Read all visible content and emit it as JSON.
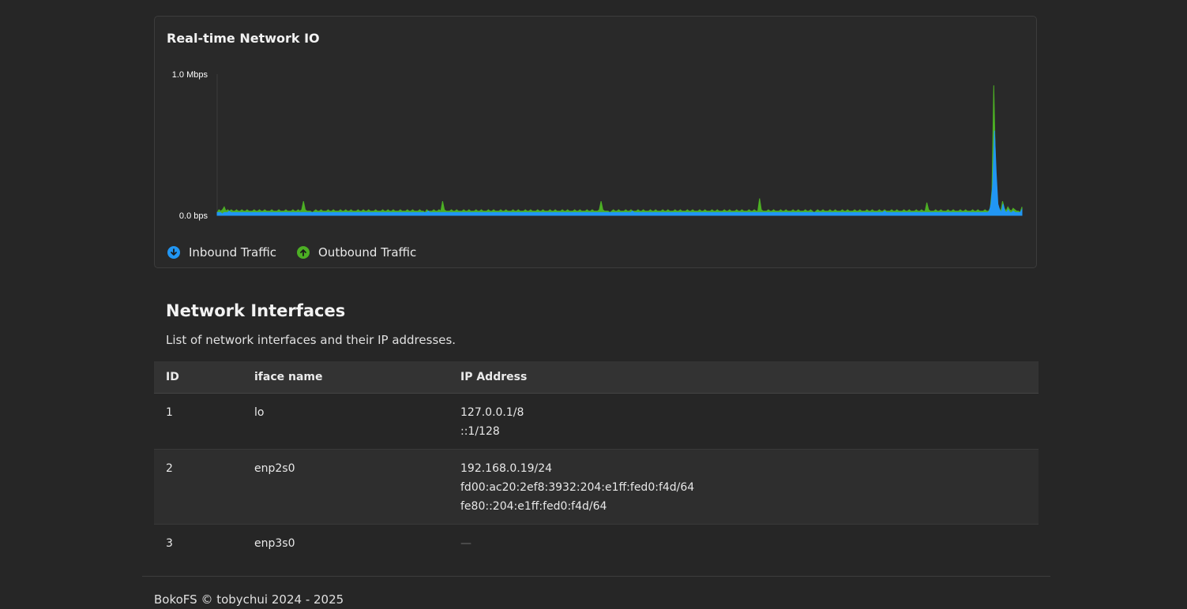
{
  "chart": {
    "title": "Real-time Network IO",
    "colors": {
      "inbound": "#2196f3",
      "outbound": "#4caf24"
    },
    "legend_icons": {
      "inbound": "arrow-down-circle-icon",
      "outbound": "arrow-up-circle-icon"
    }
  },
  "chart_data": {
    "type": "area",
    "title": "Real-time Network IO",
    "ytick_labels": [
      "1.0 Mbps",
      "0.0 bps"
    ],
    "ylim": [
      0,
      1.0
    ],
    "yunit": "Mbps",
    "grid": false,
    "legend_position": "bottom-left",
    "series": [
      {
        "name": "Inbound Traffic",
        "color": "#2196f3",
        "values": [
          0.02,
          0.02,
          0.02,
          0.01,
          0.02,
          0.02,
          0.02,
          0.03,
          0.02,
          0.02,
          0.02,
          0.02,
          0.02,
          0.02,
          0.02,
          0.02,
          0.02,
          0.02,
          0.02,
          0.02,
          0.02,
          0.02,
          0.02,
          0.02,
          0.02,
          0.02,
          0.02,
          0.02,
          0.02,
          0.02,
          0.02,
          0.02,
          0.02,
          0.02,
          0.02,
          0.02,
          0.02,
          0.02,
          0.02,
          0.02,
          0.02,
          0.02,
          0.02,
          0.02,
          0.02,
          0.02,
          0.02,
          0.02,
          0.02,
          0.02,
          0.02,
          0.02,
          0.02,
          0.02,
          0.02,
          0.02,
          0.02,
          0.02,
          0.02,
          0.02,
          0.02,
          0.02,
          0.02,
          0.02,
          0.02,
          0.02,
          0.02,
          0.02,
          0.02,
          0.02,
          0.02,
          0.02,
          0.02,
          0.02,
          0.02,
          0.02,
          0.02,
          0.02,
          0.02,
          0.02,
          0.02,
          0.02,
          0.02,
          0.02,
          0.02,
          0.02,
          0.02,
          0.02,
          0.02,
          0.02,
          0.02,
          0.02,
          0.02,
          0.02,
          0.02,
          0.02,
          0.02,
          0.02,
          0.02,
          0.02,
          0.02,
          0.02,
          0.02,
          0.02,
          0.02,
          0.02,
          0.02,
          0.02,
          0.02,
          0.02,
          0.02,
          0.02,
          0.02,
          0.02,
          0.02,
          0.02,
          0.02,
          0.02,
          0.02,
          0.02,
          0.02,
          0.02,
          0.02,
          0.03,
          0.02,
          0.02,
          0.02,
          0.02,
          0.02,
          0.02,
          0.02,
          0.02,
          0.02,
          0.02,
          0.02,
          0.02,
          0.02,
          0.02,
          0.02,
          0.02,
          0.02,
          0.02,
          0.02,
          0.02,
          0.02,
          0.02,
          0.02,
          0.02,
          0.02,
          0.02,
          0.02,
          0.02,
          0.02,
          0.02,
          0.02,
          0.02,
          0.02,
          0.02,
          0.02,
          0.02,
          0.02,
          0.02,
          0.02,
          0.02,
          0.02,
          0.02,
          0.02,
          0.02,
          0.02,
          0.02,
          0.02,
          0.02,
          0.02,
          0.02,
          0.02,
          0.02,
          0.02,
          0.02,
          0.02,
          0.02,
          0.02,
          0.02,
          0.02,
          0.02,
          0.02,
          0.02,
          0.02,
          0.02,
          0.02,
          0.02,
          0.02,
          0.02,
          0.02,
          0.02,
          0.02,
          0.02,
          0.02,
          0.02,
          0.02,
          0.02,
          0.02,
          0.02,
          0.02,
          0.02,
          0.02,
          0.02,
          0.02,
          0.02,
          0.02,
          0.02,
          0.02,
          0.02,
          0.02,
          0.02,
          0.02,
          0.02,
          0.02,
          0.02,
          0.02,
          0.02,
          0.02,
          0.02,
          0.02,
          0.02,
          0.02,
          0.02,
          0.02,
          0.02,
          0.02,
          0.02,
          0.02,
          0.02,
          0.02,
          0.02,
          0.02,
          0.02,
          0.02,
          0.02,
          0.02,
          0.02,
          0.02,
          0.02,
          0.03,
          0.02,
          0.02,
          0.02,
          0.02,
          0.02,
          0.02,
          0.02,
          0.02,
          0.02,
          0.02,
          0.02,
          0.02,
          0.02,
          0.02,
          0.02,
          0.02,
          0.02,
          0.02,
          0.02,
          0.02,
          0.02,
          0.02,
          0.02,
          0.02,
          0.02,
          0.02,
          0.02,
          0.02,
          0.02,
          0.02,
          0.02,
          0.02,
          0.02,
          0.02,
          0.02,
          0.02,
          0.02,
          0.02,
          0.02,
          0.02,
          0.02,
          0.02,
          0.02,
          0.02,
          0.02,
          0.02,
          0.02,
          0.02,
          0.02,
          0.02,
          0.02,
          0.02,
          0.02,
          0.02,
          0.02,
          0.02,
          0.02,
          0.02,
          0.02,
          0.02,
          0.02,
          0.02,
          0.02,
          0.02,
          0.02,
          0.02,
          0.02,
          0.02,
          0.02,
          0.02,
          0.02,
          0.02,
          0.02,
          0.02,
          0.02,
          0.02,
          0.02,
          0.02,
          0.02,
          0.02,
          0.02,
          0.02,
          0.02,
          0.02,
          0.02,
          0.02,
          0.02,
          0.02,
          0.02,
          0.02,
          0.02,
          0.02,
          0.02,
          0.02,
          0.02,
          0.02,
          0.02,
          0.02,
          0.02,
          0.02,
          0.02,
          0.02,
          0.02,
          0.02,
          0.02,
          0.02,
          0.02,
          0.02,
          0.02,
          0.02,
          0.02,
          0.02,
          0.02,
          0.02,
          0.02,
          0.02,
          0.02,
          0.02,
          0.02,
          0.02,
          0.02,
          0.02,
          0.02,
          0.02,
          0.02,
          0.02,
          0.02,
          0.02,
          0.02,
          0.02,
          0.02,
          0.02,
          0.02,
          0.02,
          0.02,
          0.02,
          0.02,
          0.02,
          0.02,
          0.02,
          0.02,
          0.02,
          0.02,
          0.02,
          0.02,
          0.02,
          0.03,
          0.02,
          0.02,
          0.02,
          0.02,
          0.02,
          0.02,
          0.02,
          0.02,
          0.02,
          0.02,
          0.02,
          0.02,
          0.02,
          0.02,
          0.02,
          0.02,
          0.02,
          0.02,
          0.02,
          0.02,
          0.02,
          0.02,
          0.02,
          0.02,
          0.02,
          0.02,
          0.02,
          0.02,
          0.02,
          0.02,
          0.02,
          0.02,
          0.02,
          0.02,
          0.02,
          0.02,
          0.02,
          0.02,
          0.02,
          0.02,
          0.02,
          0.02,
          0.02,
          0.02,
          0.02,
          0.02,
          0.02,
          0.02,
          0.02,
          0.02,
          0.02,
          0.02,
          0.02,
          0.02,
          0.02,
          0.02,
          0.02,
          0.02,
          0.02,
          0.02,
          0.03,
          0.08,
          0.22,
          0.6,
          0.3,
          0.08,
          0.04,
          0.02,
          0.08,
          0.03,
          0.02,
          0.04,
          0.02,
          0.02,
          0.03,
          0.02,
          0.02,
          0.02,
          0.02,
          0.04
        ]
      },
      {
        "name": "Outbound Traffic",
        "color": "#4caf24",
        "values": [
          0.02,
          0.04,
          0.03,
          0.04,
          0.06,
          0.03,
          0.04,
          0.03,
          0.04,
          0.03,
          0.03,
          0.04,
          0.03,
          0.03,
          0.04,
          0.03,
          0.03,
          0.04,
          0.03,
          0.03,
          0.03,
          0.04,
          0.03,
          0.03,
          0.04,
          0.03,
          0.03,
          0.04,
          0.03,
          0.03,
          0.03,
          0.04,
          0.03,
          0.03,
          0.03,
          0.04,
          0.03,
          0.03,
          0.03,
          0.04,
          0.03,
          0.03,
          0.03,
          0.04,
          0.03,
          0.03,
          0.04,
          0.03,
          0.04,
          0.1,
          0.04,
          0.03,
          0.03,
          0.03,
          0.02,
          0.03,
          0.04,
          0.03,
          0.03,
          0.04,
          0.03,
          0.03,
          0.03,
          0.04,
          0.03,
          0.03,
          0.04,
          0.03,
          0.03,
          0.03,
          0.04,
          0.03,
          0.03,
          0.04,
          0.03,
          0.03,
          0.04,
          0.03,
          0.03,
          0.03,
          0.04,
          0.03,
          0.03,
          0.04,
          0.03,
          0.03,
          0.04,
          0.03,
          0.03,
          0.03,
          0.04,
          0.03,
          0.03,
          0.03,
          0.04,
          0.03,
          0.03,
          0.04,
          0.03,
          0.03,
          0.04,
          0.03,
          0.03,
          0.03,
          0.04,
          0.03,
          0.03,
          0.03,
          0.04,
          0.03,
          0.03,
          0.04,
          0.03,
          0.03,
          0.03,
          0.04,
          0.03,
          0.03,
          0.02,
          0.04,
          0.03,
          0.03,
          0.03,
          0.04,
          0.03,
          0.03,
          0.04,
          0.03,
          0.1,
          0.04,
          0.03,
          0.03,
          0.03,
          0.04,
          0.03,
          0.03,
          0.04,
          0.03,
          0.03,
          0.03,
          0.04,
          0.03,
          0.03,
          0.04,
          0.03,
          0.03,
          0.03,
          0.04,
          0.03,
          0.03,
          0.04,
          0.03,
          0.03,
          0.03,
          0.04,
          0.03,
          0.03,
          0.04,
          0.03,
          0.03,
          0.03,
          0.04,
          0.03,
          0.03,
          0.04,
          0.03,
          0.03,
          0.03,
          0.04,
          0.03,
          0.03,
          0.04,
          0.03,
          0.03,
          0.03,
          0.04,
          0.03,
          0.03,
          0.04,
          0.03,
          0.03,
          0.03,
          0.04,
          0.03,
          0.03,
          0.04,
          0.03,
          0.03,
          0.03,
          0.04,
          0.03,
          0.03,
          0.04,
          0.03,
          0.03,
          0.03,
          0.04,
          0.03,
          0.03,
          0.04,
          0.03,
          0.03,
          0.03,
          0.04,
          0.03,
          0.03,
          0.04,
          0.03,
          0.03,
          0.03,
          0.04,
          0.03,
          0.03,
          0.04,
          0.03,
          0.03,
          0.03,
          0.04,
          0.1,
          0.04,
          0.03,
          0.03,
          0.03,
          0.02,
          0.03,
          0.04,
          0.03,
          0.03,
          0.04,
          0.03,
          0.03,
          0.03,
          0.04,
          0.03,
          0.03,
          0.04,
          0.03,
          0.03,
          0.03,
          0.04,
          0.03,
          0.03,
          0.04,
          0.03,
          0.03,
          0.03,
          0.04,
          0.03,
          0.03,
          0.04,
          0.03,
          0.03,
          0.03,
          0.04,
          0.03,
          0.03,
          0.04,
          0.03,
          0.03,
          0.03,
          0.04,
          0.03,
          0.03,
          0.04,
          0.03,
          0.03,
          0.03,
          0.04,
          0.03,
          0.03,
          0.04,
          0.03,
          0.03,
          0.03,
          0.04,
          0.03,
          0.03,
          0.04,
          0.03,
          0.03,
          0.03,
          0.04,
          0.03,
          0.03,
          0.04,
          0.03,
          0.03,
          0.03,
          0.04,
          0.03,
          0.03,
          0.04,
          0.03,
          0.03,
          0.03,
          0.04,
          0.03,
          0.03,
          0.04,
          0.03,
          0.03,
          0.03,
          0.04,
          0.03,
          0.03,
          0.04,
          0.03,
          0.03,
          0.12,
          0.04,
          0.03,
          0.03,
          0.03,
          0.04,
          0.03,
          0.03,
          0.04,
          0.03,
          0.03,
          0.03,
          0.04,
          0.03,
          0.03,
          0.04,
          0.03,
          0.03,
          0.03,
          0.04,
          0.03,
          0.03,
          0.04,
          0.03,
          0.03,
          0.03,
          0.04,
          0.03,
          0.03,
          0.04,
          0.03,
          0.02,
          0.03,
          0.04,
          0.03,
          0.03,
          0.04,
          0.03,
          0.03,
          0.03,
          0.04,
          0.03,
          0.03,
          0.04,
          0.03,
          0.03,
          0.03,
          0.04,
          0.03,
          0.03,
          0.04,
          0.03,
          0.03,
          0.03,
          0.04,
          0.03,
          0.03,
          0.04,
          0.03,
          0.03,
          0.03,
          0.04,
          0.03,
          0.03,
          0.04,
          0.03,
          0.03,
          0.03,
          0.04,
          0.03,
          0.03,
          0.04,
          0.03,
          0.03,
          0.03,
          0.04,
          0.03,
          0.03,
          0.04,
          0.03,
          0.03,
          0.03,
          0.04,
          0.03,
          0.03,
          0.04,
          0.03,
          0.03,
          0.03,
          0.04,
          0.03,
          0.03,
          0.04,
          0.03,
          0.03,
          0.09,
          0.04,
          0.03,
          0.03,
          0.03,
          0.04,
          0.03,
          0.03,
          0.04,
          0.03,
          0.03,
          0.03,
          0.04,
          0.03,
          0.03,
          0.04,
          0.03,
          0.03,
          0.03,
          0.04,
          0.03,
          0.03,
          0.04,
          0.03,
          0.03,
          0.03,
          0.04,
          0.03,
          0.03,
          0.04,
          0.03,
          0.03,
          0.03,
          0.04,
          0.03,
          0.03,
          0.05,
          0.18,
          0.92,
          0.35,
          0.08,
          0.05,
          0.03,
          0.1,
          0.05,
          0.03,
          0.06,
          0.04,
          0.03,
          0.05,
          0.04,
          0.03,
          0.03,
          0.02,
          0.06
        ]
      }
    ]
  },
  "legend": {
    "inbound_label": "Inbound Traffic",
    "outbound_label": "Outbound Traffic"
  },
  "interfaces": {
    "title": "Network Interfaces",
    "description": "List of network interfaces and their IP addresses.",
    "columns": [
      "ID",
      "iface name",
      "IP Address"
    ],
    "rows": [
      {
        "id": "1",
        "name": "lo",
        "ips": [
          "127.0.0.1/8",
          "::1/128"
        ]
      },
      {
        "id": "2",
        "name": "enp2s0",
        "ips": [
          "192.168.0.19/24",
          "fd00:ac20:2ef8:3932:204:e1ff:fed0:f4d/64",
          "fe80::204:e1ff:fed0:f4d/64"
        ]
      },
      {
        "id": "3",
        "name": "enp3s0",
        "ips": [
          "—"
        ]
      }
    ]
  },
  "footer": {
    "text": "BokoFS © tobychui 2024 - 2025"
  }
}
